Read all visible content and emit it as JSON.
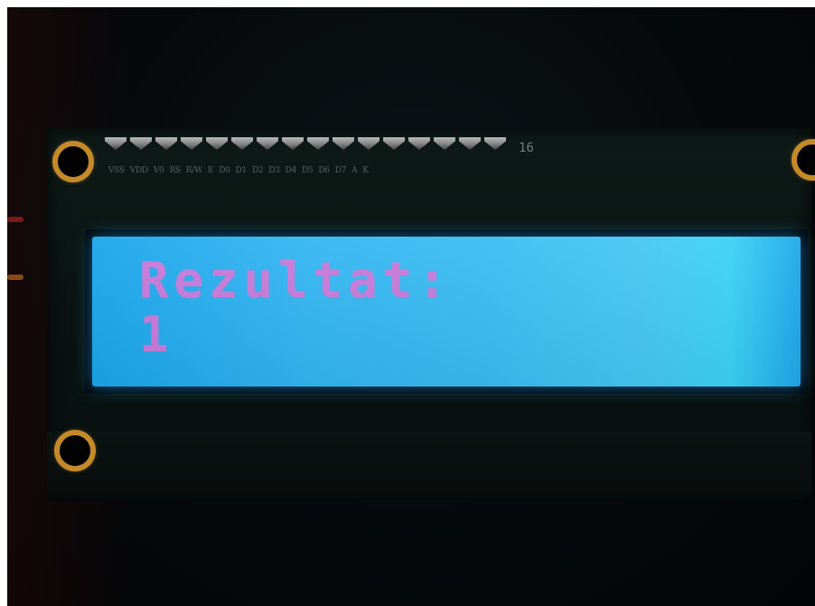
{
  "lcd": {
    "line1": "Rezultat:",
    "line2": "1",
    "backlight_color": "#33b6f2",
    "text_color": "#c77ad9"
  },
  "board": {
    "pin_count_label": "16",
    "pin_labels": [
      "VSS",
      "VDD",
      "V0",
      "RS",
      "R/W",
      "E",
      "D0",
      "D1",
      "D2",
      "D3",
      "D4",
      "D5",
      "D6",
      "D7",
      "A",
      "K"
    ]
  }
}
